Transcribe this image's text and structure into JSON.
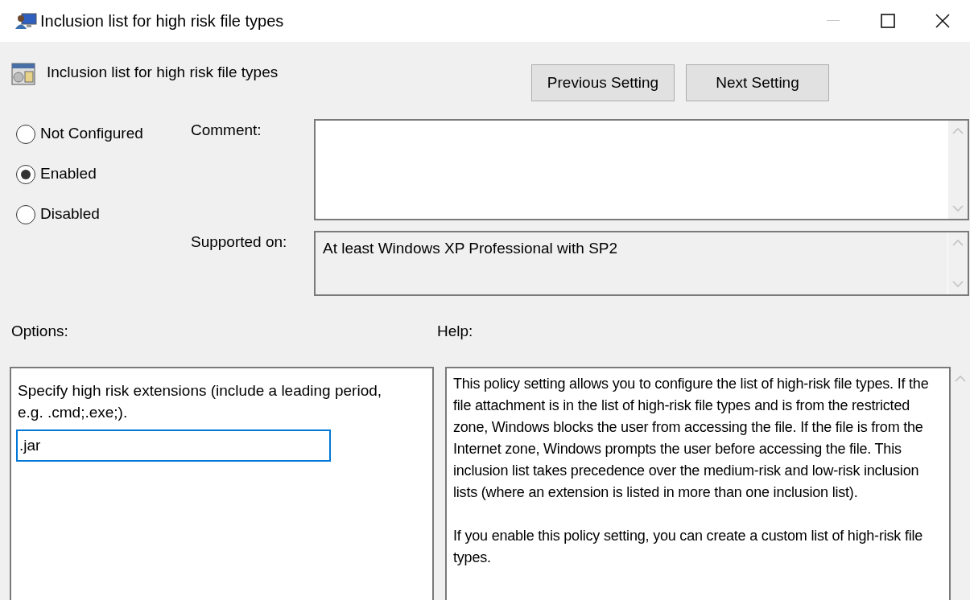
{
  "window": {
    "title": "Inclusion list for high risk file types"
  },
  "header": {
    "title": "Inclusion list for high risk file types"
  },
  "nav_buttons": [
    {
      "label": "Previous Setting"
    },
    {
      "label": "Next Setting"
    }
  ],
  "state_options": [
    {
      "label": "Not Configured",
      "selected": false
    },
    {
      "label": "Enabled",
      "selected": true
    },
    {
      "label": "Disabled",
      "selected": false
    }
  ],
  "comment": {
    "label": "Comment:"
  },
  "supported_on": {
    "label": "Supported on:",
    "value": "At least Windows XP Professional with SP2"
  },
  "options": {
    "label": "Options:",
    "description": "Specify high risk extensions (include a leading period, e.g. .cmd;.exe;).",
    "value": ".jar"
  },
  "help": {
    "label": "Help:",
    "paragraphs": [
      "This policy setting allows you to configure the list of high-risk file types. If the file attachment is in the list of high-risk file types and is from the restricted zone, Windows blocks the user from accessing the file. If the file is from the Internet zone, Windows prompts the user before accessing the file. This inclusion list takes precedence over the medium-risk and low-risk inclusion lists (where an extension is listed in more than one inclusion list).",
      "If you enable this policy setting, you can create a custom list of high-risk file types."
    ]
  }
}
